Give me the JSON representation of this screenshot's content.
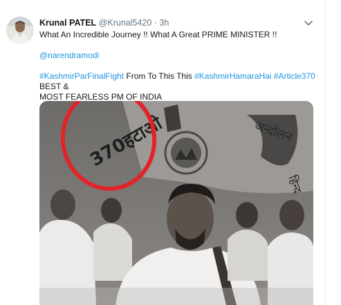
{
  "tweet": {
    "author_name": "Krunal PATEL",
    "handle": "@Krunal5420",
    "separator": "·",
    "time": "3h",
    "line1": "What An Incredible Journey !! What A Great PRIME MINISTER !!",
    "mention": "@narendramodi",
    "hashtag1": "#KashmirParFinalFight",
    "text_mid": " From To This This ",
    "hashtag2": "#KashmirHamaraHai",
    "hashtag3": "#Article370",
    "text_end1": " BEST &",
    "text_end2": "MOST FEARLESS PM OF INDIA",
    "photo_banner_text": "370हटाओ"
  },
  "icons": {
    "avatar": "avatar-photo",
    "menu": "chevron-down-icon"
  },
  "colors": {
    "link": "#1b95e0",
    "text": "#14171a",
    "muted": "#657786",
    "highlight_circle": "#e0242a"
  }
}
